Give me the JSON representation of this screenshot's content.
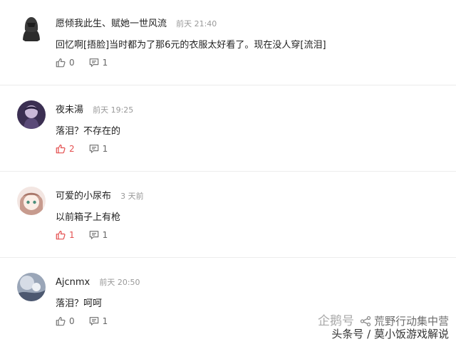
{
  "comments": [
    {
      "username": "愿倾我此生、赋她一世风流",
      "time": "前天 21:40",
      "text": "回忆啊[捂脸]当时都为了那6元的衣服太好看了。现在没人穿[流泪]",
      "likes": "0",
      "replies": "1",
      "liked": false
    },
    {
      "username": "夜未湯",
      "time": "前天 19:25",
      "text": "落泪？不存在的",
      "likes": "2",
      "replies": "1",
      "liked": true
    },
    {
      "username": "可爱的小尿布",
      "time": "3 天前",
      "text": "以前箱子上有枪",
      "likes": "1",
      "replies": "1",
      "liked": true
    },
    {
      "username": "Ajcnmx",
      "time": "前天 20:50",
      "text": "落泪？呵呵",
      "likes": "0",
      "replies": "1",
      "liked": false
    }
  ],
  "watermark": {
    "brand": "企鹅号",
    "channel": "荒野行动集中营",
    "line2": "头条号 / 莫小饭游戏解说"
  },
  "colors": {
    "like_active": "#e45050",
    "icon_default": "#777777"
  }
}
